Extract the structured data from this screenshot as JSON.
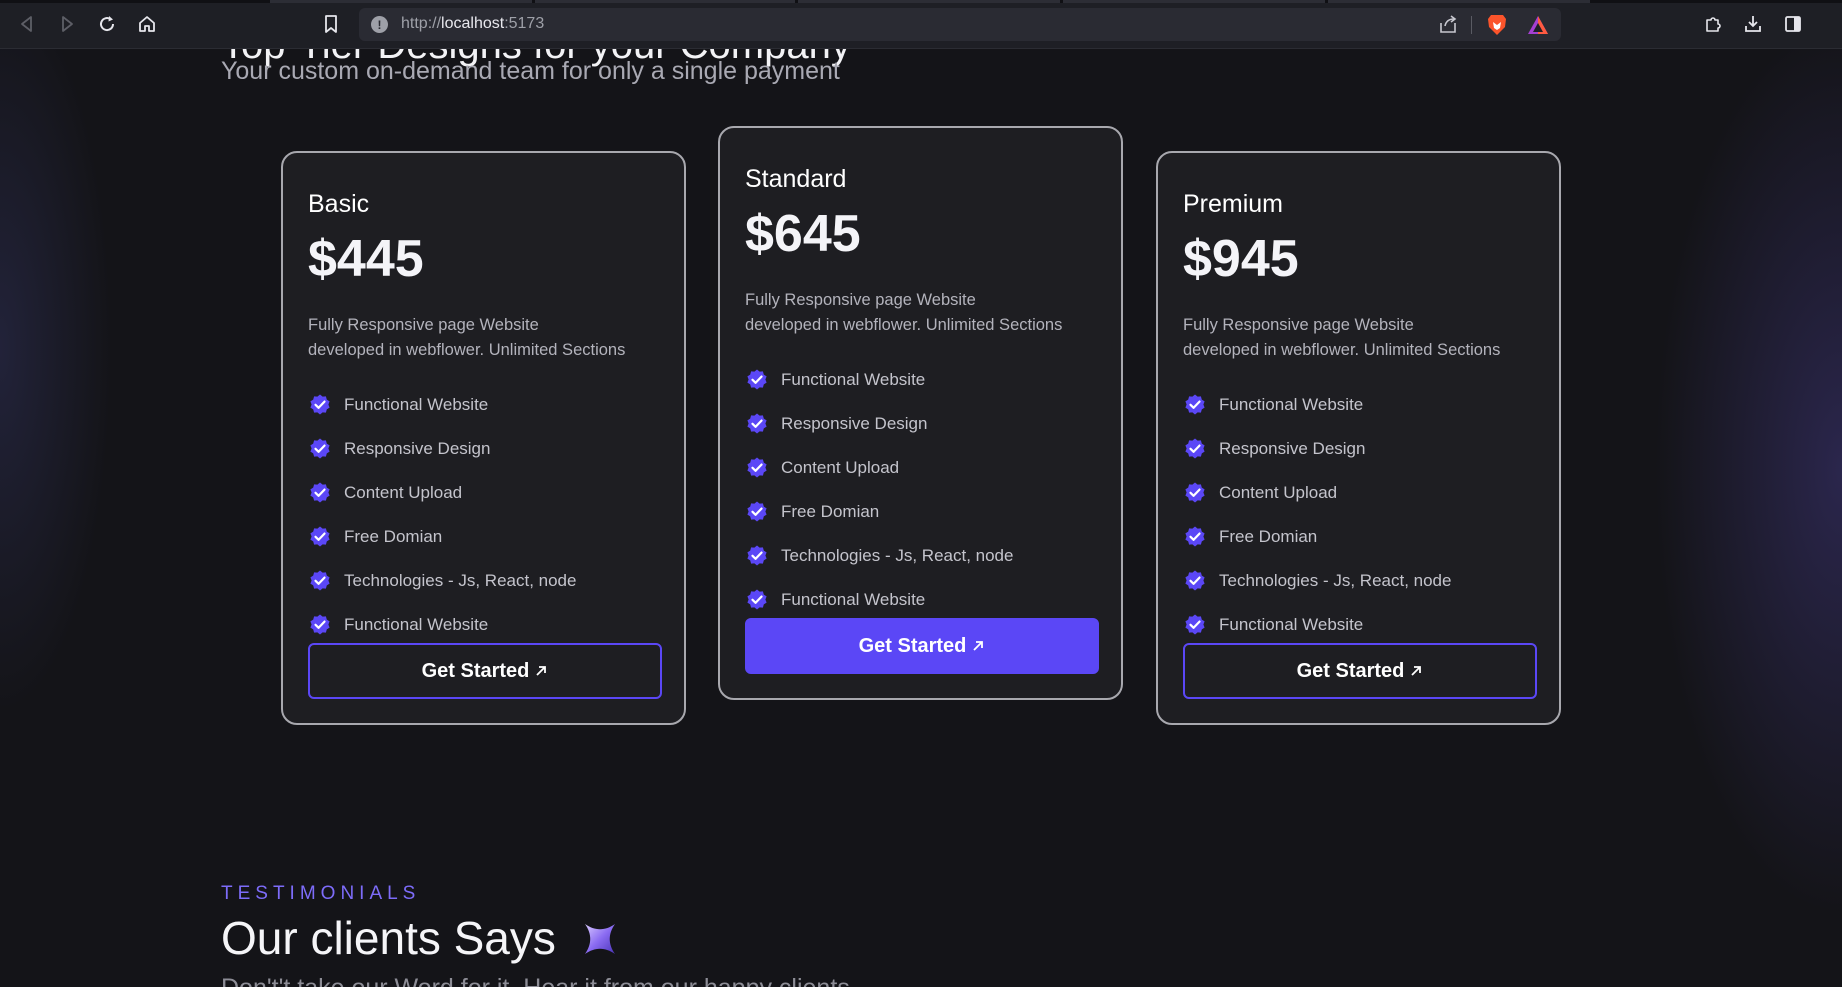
{
  "browser": {
    "url_scheme": "http://",
    "url_host": "localhost",
    "url_port": ":5173"
  },
  "page": {
    "cut_heading": "Top-Tier Designs for your Company",
    "subtitle": "Your custom on-demand team for only a single payment"
  },
  "pricing": {
    "cards": [
      {
        "name": "Basic",
        "price": "$445",
        "desc_line1": "Fully Responsive page Website",
        "desc_line2": "developed in webflower. Unlimited Sections",
        "features": [
          "Functional Website",
          "Responsive Design",
          "Content Upload",
          "Free Domian",
          "Technologies - Js, React, node",
          "Functional Website"
        ],
        "cta": "Get Started"
      },
      {
        "name": "Standard",
        "price": "$645",
        "desc_line1": "Fully Responsive page Website",
        "desc_line2": "developed in webflower. Unlimited Sections",
        "features": [
          "Functional Website",
          "Responsive Design",
          "Content Upload",
          "Free Domian",
          "Technologies - Js, React, node",
          "Functional Website"
        ],
        "cta": "Get Started"
      },
      {
        "name": "Premium",
        "price": "$945",
        "desc_line1": "Fully Responsive page Website",
        "desc_line2": "developed in webflower. Unlimited Sections",
        "features": [
          "Functional Website",
          "Responsive Design",
          "Content Upload",
          "Free Domian",
          "Technologies - Js, React, node",
          "Functional Website"
        ],
        "cta": "Get Started"
      }
    ]
  },
  "testimonials": {
    "eyebrow": "TESTIMONIALS",
    "title": "Our clients Says",
    "cut_para": "Don't't take our Word for it. Hear it from our happy clients"
  },
  "colors": {
    "accent": "#5b47f6",
    "eyebrow": "#7d6cf9",
    "card_bg": "#1e1e22",
    "page_bg": "#141418"
  },
  "icons": {
    "feature": "check-badge-icon",
    "cta": "arrow-up-right-icon",
    "sparkle": "sparkle-icon"
  }
}
